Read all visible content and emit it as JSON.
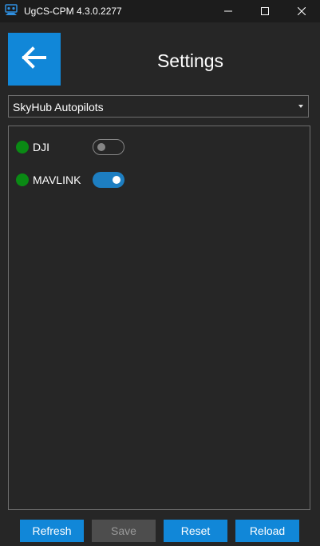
{
  "window": {
    "title": "UgCS-CPM 4.3.0.2277",
    "icons": {
      "app": "ugcs-app-icon",
      "minimize": "minimize-icon",
      "maximize": "maximize-icon",
      "close": "close-icon"
    }
  },
  "header": {
    "back_icon": "arrow-left-icon",
    "title": "Settings"
  },
  "category_select": {
    "selected": "SkyHub Autopilots",
    "icon": "chevron-down-icon"
  },
  "autopilots": [
    {
      "label": "DJI",
      "status": "connected",
      "enabled": false
    },
    {
      "label": "MAVLINK",
      "status": "connected",
      "enabled": true
    }
  ],
  "buttons": {
    "refresh": "Refresh",
    "save": "Save",
    "save_enabled": false,
    "reset": "Reset",
    "reload": "Reload"
  },
  "colors": {
    "accent": "#1187d8",
    "status_ok": "#0a8a14",
    "background": "#262626",
    "titlebar": "#1c1c1c",
    "disabled_button": "#4d4d4d"
  }
}
